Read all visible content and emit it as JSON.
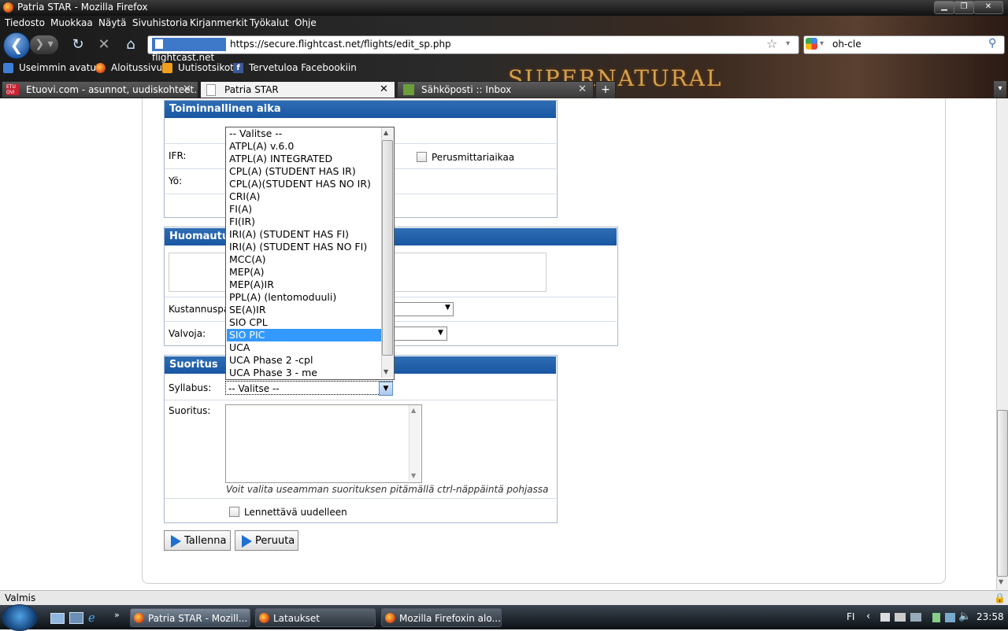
{
  "window": {
    "title": "Patria STAR - Mozilla Firefox"
  },
  "menu": [
    "Tiedosto",
    "Muokkaa",
    "Näytä",
    "Sivuhistoria",
    "Kirjanmerkit",
    "Työkalut",
    "Ohje"
  ],
  "nav": {
    "site_badge": "flightcast.net",
    "url": "https://secure.flightcast.net/flights/edit_sp.php",
    "search": "oh-cle"
  },
  "bookmarks": [
    "Useimmin avatut",
    "Aloitussivu",
    "Uutisotsikot",
    "Tervetuloa Facebookiin"
  ],
  "tabs": [
    {
      "label": "Etuovi.com - asunnot, uudiskohteet...",
      "active": false
    },
    {
      "label": "Patria STAR",
      "active": true
    },
    {
      "label": "Sähköposti :: Inbox",
      "active": false
    }
  ],
  "persona_text": "SUPERNATURAL",
  "form": {
    "section1": {
      "title": "Toiminnallinen aika",
      "ifr_label": "IFR:",
      "yo_label": "Yö:",
      "perus_label": "Perusmittariaikaa"
    },
    "section2": {
      "title": "Huomautuk",
      "kustannus_label": "Kustannuspa",
      "valvoja_label": "Valvoja:"
    },
    "section3": {
      "title": "Suoritus",
      "syllabus_label": "Syllabus:",
      "syllabus_value": "-- Valitse --",
      "suoritus_label": "Suoritus:",
      "hint": "Voit valita useamman suorituksen pitämällä ctrl-näppäintä pohjassa",
      "relfly_label": "Lennettävä uudelleen"
    },
    "buttons": {
      "save": "Tallenna",
      "cancel": "Peruuta"
    }
  },
  "dropdown": {
    "options": [
      "-- Valitse --",
      "ATPL(A) v.6.0",
      "ATPL(A) INTEGRATED",
      "CPL(A) (STUDENT HAS IR)",
      "CPL(A)(STUDENT HAS NO IR)",
      "CRI(A)",
      "FI(A)",
      "FI(IR)",
      "IRI(A) (STUDENT HAS FI)",
      "IRI(A) (STUDENT HAS NO FI)",
      "MCC(A)",
      "MEP(A)",
      "MEP(A)IR",
      "PPL(A) (lentomoduuli)",
      "SE(A)IR",
      "SIO CPL",
      "SIO PIC",
      "UCA",
      "UCA Phase 2 -cpl",
      "UCA Phase 3 - me"
    ],
    "selected": "SIO PIC"
  },
  "status": {
    "text": "Valmis"
  },
  "taskbar": {
    "items": [
      "Patria STAR - Mozill...",
      "Lataukset",
      "Mozilla Firefoxin alo..."
    ],
    "lang": "FI",
    "clock": "23:58"
  }
}
